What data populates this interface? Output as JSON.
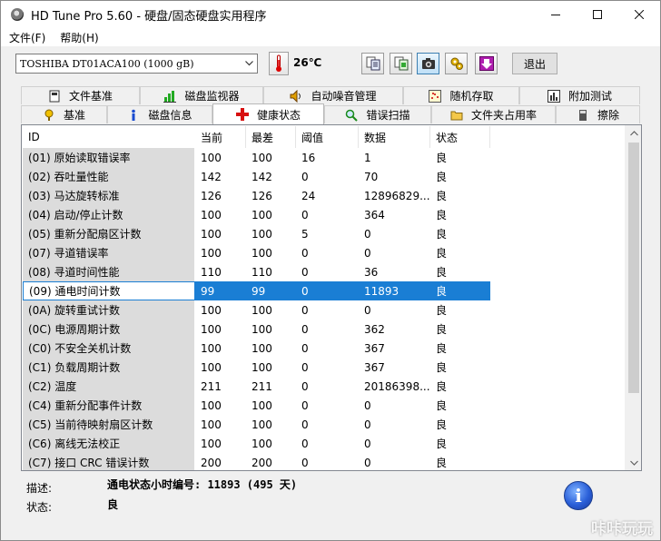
{
  "window": {
    "title": "HD Tune Pro 5.60 - 硬盘/固态硬盘实用程序"
  },
  "menu": {
    "file": "文件(F)",
    "help": "帮助(H)"
  },
  "toolbar": {
    "drive": "TOSHIBA DT01ACA100 (1000 gB)",
    "temperature": "26℃",
    "exit_label": "退出"
  },
  "tabs_row1": [
    "文件基准",
    "磁盘监视器",
    "自动噪音管理",
    "随机存取",
    "附加测试"
  ],
  "tabs_row2": [
    "基准",
    "磁盘信息",
    "健康状态",
    "错误扫描",
    "文件夹占用率",
    "擦除"
  ],
  "selected_tab": "健康状态",
  "table": {
    "headers": [
      "ID",
      "当前",
      "最差",
      "阈值",
      "数据",
      "状态"
    ],
    "rows": [
      [
        "(01) 原始读取错误率",
        "100",
        "100",
        "16",
        "1",
        "良"
      ],
      [
        "(02) 吞吐量性能",
        "142",
        "142",
        "0",
        "70",
        "良"
      ],
      [
        "(03) 马达旋转标准",
        "126",
        "126",
        "24",
        "12896829...",
        "良"
      ],
      [
        "(04) 启动/停止计数",
        "100",
        "100",
        "0",
        "364",
        "良"
      ],
      [
        "(05) 重新分配扇区计数",
        "100",
        "100",
        "5",
        "0",
        "良"
      ],
      [
        "(07) 寻道错误率",
        "100",
        "100",
        "0",
        "0",
        "良"
      ],
      [
        "(08) 寻道时间性能",
        "110",
        "110",
        "0",
        "36",
        "良"
      ],
      [
        "(09) 通电时间计数",
        "99",
        "99",
        "0",
        "11893",
        "良"
      ],
      [
        "(0A) 旋转重试计数",
        "100",
        "100",
        "0",
        "0",
        "良"
      ],
      [
        "(0C) 电源周期计数",
        "100",
        "100",
        "0",
        "362",
        "良"
      ],
      [
        "(C0) 不安全关机计数",
        "100",
        "100",
        "0",
        "367",
        "良"
      ],
      [
        "(C1) 负载周期计数",
        "100",
        "100",
        "0",
        "367",
        "良"
      ],
      [
        "(C2) 温度",
        "211",
        "211",
        "0",
        "20186398...",
        "良"
      ],
      [
        "(C4) 重新分配事件计数",
        "100",
        "100",
        "0",
        "0",
        "良"
      ],
      [
        "(C5) 当前待映射扇区计数",
        "100",
        "100",
        "0",
        "0",
        "良"
      ],
      [
        "(C6) 离线无法校正",
        "100",
        "100",
        "0",
        "0",
        "良"
      ],
      [
        "(C7) 接口 CRC 错误计数",
        "200",
        "200",
        "0",
        "0",
        "良"
      ]
    ],
    "selected_row": 7
  },
  "details": {
    "description_label": "描述:",
    "description_value": "通电状态小时编号: 11893 (495 天)",
    "status_label": "状态:",
    "status_value": "良"
  },
  "watermark": "咔咔玩玩",
  "colors": {
    "selection": "#1a7ed4",
    "id_column_bg": "#dcdcdc"
  }
}
